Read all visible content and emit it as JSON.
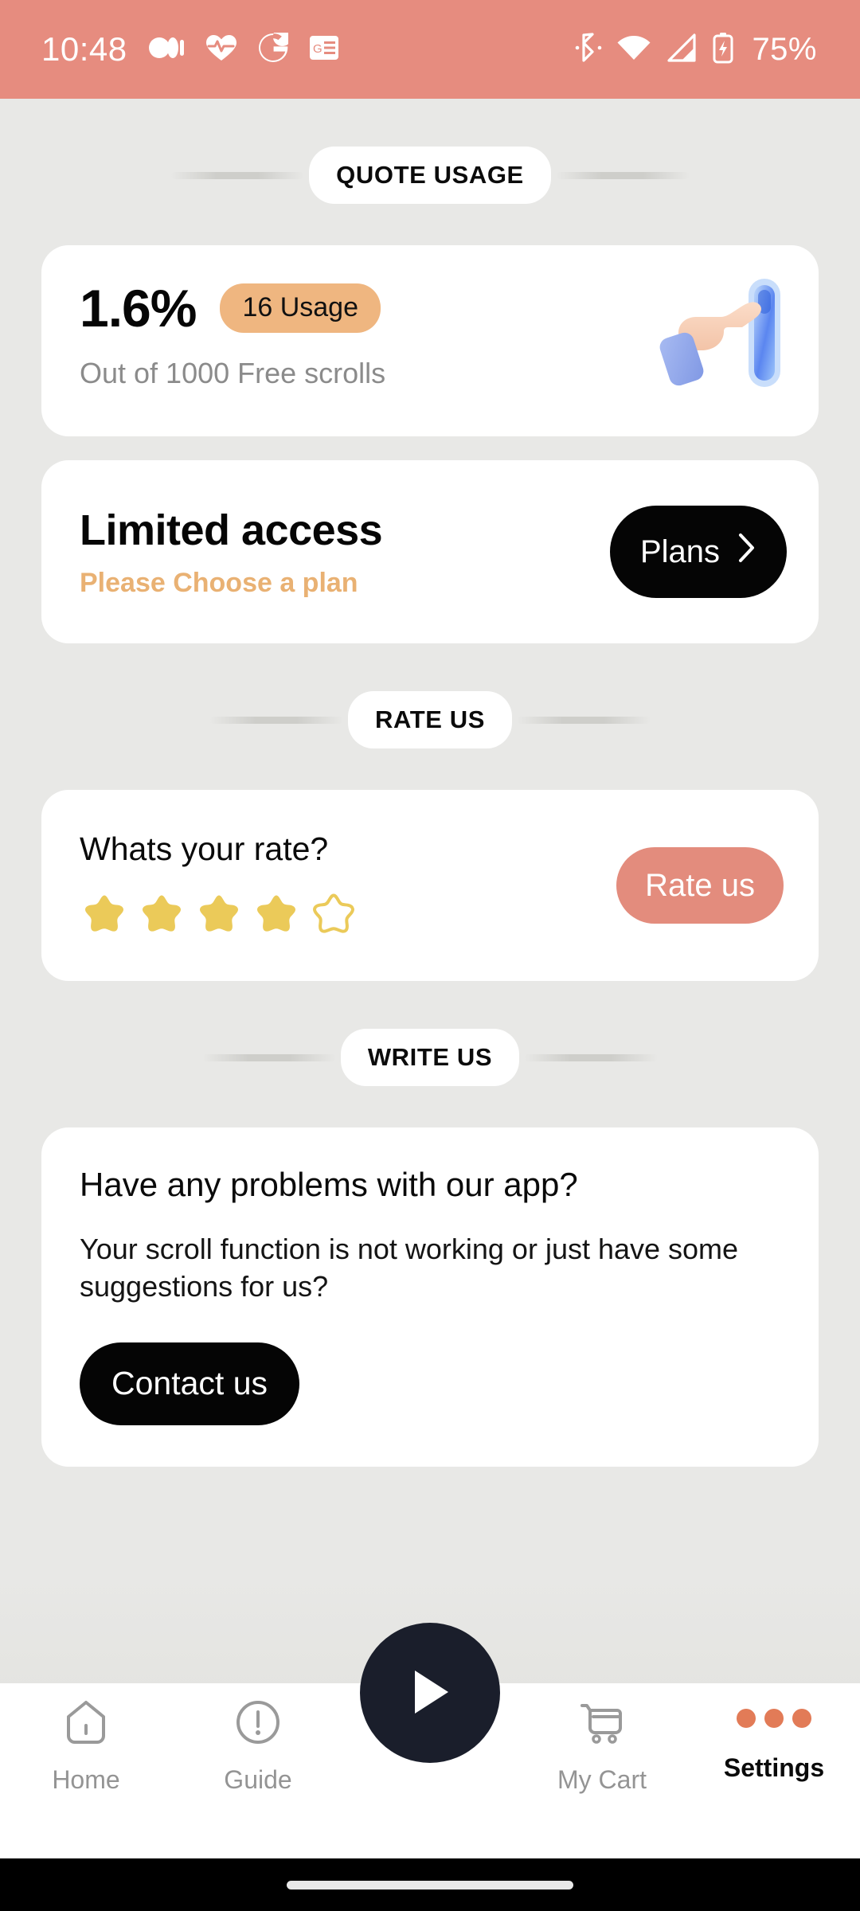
{
  "status_bar": {
    "time": "10:48",
    "battery_percent": "75%",
    "left_icons": [
      "dots-media-icon",
      "heart-pulse-icon",
      "google-g-icon",
      "google-news-icon"
    ],
    "right_icons": [
      "bluetooth-icon",
      "wifi-icon",
      "cellular-signal-icon",
      "battery-charging-icon"
    ],
    "background_color": "#E68C7F"
  },
  "sections": {
    "quote_usage": {
      "header": "QUOTE USAGE",
      "percent": "1.6%",
      "badge": "16 Usage",
      "subtitle": "Out of 1000 Free scrolls",
      "badge_color": "#EFB680",
      "illustration": "hand-pressing-button-icon"
    },
    "limited_access": {
      "title": "Limited access",
      "subtitle": "Please Choose a plan",
      "subtitle_color": "#E9B173",
      "button_label": "Plans",
      "button_icon": "chevron-right-icon"
    },
    "rate_us": {
      "header": "RATE US",
      "question": "Whats your rate?",
      "rating": 4,
      "max_rating": 5,
      "star_color": "#EBCA59",
      "button_label": "Rate us",
      "button_color": "#E38C7D"
    },
    "write_us": {
      "header": "WRITE US",
      "title": "Have any problems with our app?",
      "description": "Your scroll function is not working or just have some suggestions for us?",
      "button_label": "Contact us"
    }
  },
  "bottom_nav": {
    "items": [
      {
        "label": "Home",
        "icon": "home-icon",
        "active": false
      },
      {
        "label": "Guide",
        "icon": "exclamation-circle-icon",
        "active": false
      },
      {
        "label": "My Cart",
        "icon": "shopping-cart-icon",
        "active": false
      },
      {
        "label": "Settings",
        "icon": "three-dots-icon",
        "active": true
      }
    ],
    "fab": {
      "icon": "play-icon",
      "color": "#1A1E2B"
    },
    "active_accent": "#E27B57"
  }
}
